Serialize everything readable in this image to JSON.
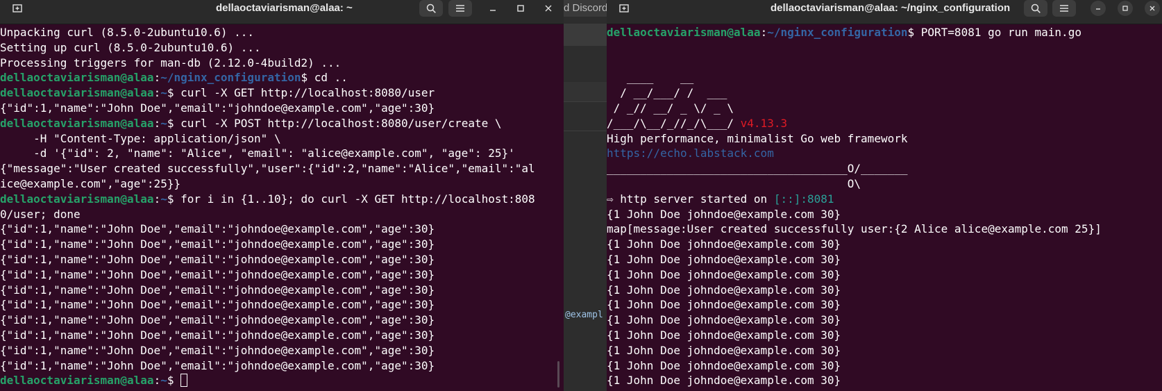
{
  "left": {
    "title": "dellaoctaviarisman@alaa: ~",
    "lines": [
      [
        {
          "t": "Unpacking curl (8.5.0-2ubuntu10.6) ..."
        }
      ],
      [
        {
          "t": "Setting up curl (8.5.0-2ubuntu10.6) ..."
        }
      ],
      [
        {
          "t": "Processing triggers for man-db (2.12.0-4build2) ..."
        }
      ],
      [
        {
          "t": "dellaoctaviarisman@alaa",
          "c": "u"
        },
        {
          "t": ":"
        },
        {
          "t": "~/nginx_configuration",
          "c": "p"
        },
        {
          "t": "$ cd .."
        }
      ],
      [
        {
          "t": "dellaoctaviarisman@alaa",
          "c": "u"
        },
        {
          "t": ":"
        },
        {
          "t": "~",
          "c": "p"
        },
        {
          "t": "$ curl -X GET http://localhost:8080/user"
        }
      ],
      [
        {
          "t": "{\"id\":1,\"name\":\"John Doe\",\"email\":\"johndoe@example.com\",\"age\":30}"
        }
      ],
      [
        {
          "t": "dellaoctaviarisman@alaa",
          "c": "u"
        },
        {
          "t": ":"
        },
        {
          "t": "~",
          "c": "p"
        },
        {
          "t": "$ curl -X POST http://localhost:8080/user/create \\"
        }
      ],
      [
        {
          "t": "     -H \"Content-Type: application/json\" \\"
        }
      ],
      [
        {
          "t": "     -d '{\"id\": 2, \"name\": \"Alice\", \"email\": \"alice@example.com\", \"age\": 25}'"
        }
      ],
      [
        {
          "t": "{\"message\":\"User created successfully\",\"user\":{\"id\":2,\"name\":\"Alice\",\"email\":\"al"
        }
      ],
      [
        {
          "t": "ice@example.com\",\"age\":25}}"
        }
      ],
      [
        {
          "t": "dellaoctaviarisman@alaa",
          "c": "u"
        },
        {
          "t": ":"
        },
        {
          "t": "~",
          "c": "p"
        },
        {
          "t": "$ for i in {1..10}; do curl -X GET http://localhost:808"
        }
      ],
      [
        {
          "t": "0/user; done"
        }
      ],
      [
        {
          "t": "{\"id\":1,\"name\":\"John Doe\",\"email\":\"johndoe@example.com\",\"age\":30}"
        }
      ],
      [
        {
          "t": "{\"id\":1,\"name\":\"John Doe\",\"email\":\"johndoe@example.com\",\"age\":30}"
        }
      ],
      [
        {
          "t": "{\"id\":1,\"name\":\"John Doe\",\"email\":\"johndoe@example.com\",\"age\":30}"
        }
      ],
      [
        {
          "t": "{\"id\":1,\"name\":\"John Doe\",\"email\":\"johndoe@example.com\",\"age\":30}"
        }
      ],
      [
        {
          "t": "{\"id\":1,\"name\":\"John Doe\",\"email\":\"johndoe@example.com\",\"age\":30}"
        }
      ],
      [
        {
          "t": "{\"id\":1,\"name\":\"John Doe\",\"email\":\"johndoe@example.com\",\"age\":30}"
        }
      ],
      [
        {
          "t": "{\"id\":1,\"name\":\"John Doe\",\"email\":\"johndoe@example.com\",\"age\":30}"
        }
      ],
      [
        {
          "t": "{\"id\":1,\"name\":\"John Doe\",\"email\":\"johndoe@example.com\",\"age\":30}"
        }
      ],
      [
        {
          "t": "{\"id\":1,\"name\":\"John Doe\",\"email\":\"johndoe@example.com\",\"age\":30}"
        }
      ],
      [
        {
          "t": "{\"id\":1,\"name\":\"John Doe\",\"email\":\"johndoe@example.com\",\"age\":30}"
        }
      ],
      [
        {
          "t": "dellaoctaviarisman@alaa",
          "c": "u"
        },
        {
          "t": ":"
        },
        {
          "t": "~",
          "c": "p"
        },
        {
          "t": "$ "
        },
        {
          "t": "",
          "c": "cursor"
        }
      ]
    ]
  },
  "middle": {
    "title_fragment": "d Discord",
    "text_fragment": "@exampl"
  },
  "right": {
    "title": "dellaoctaviarisman@alaa: ~/nginx_configuration",
    "lines": [
      [
        {
          "t": "dellaoctaviarisman@alaa",
          "c": "u"
        },
        {
          "t": ":"
        },
        {
          "t": "~/nginx_configuration",
          "c": "p"
        },
        {
          "t": "$ PORT=8081 go run main.go"
        }
      ],
      [
        {
          "t": ""
        }
      ],
      [
        {
          "t": ""
        }
      ],
      [
        {
          "t": "   ____    __"
        }
      ],
      [
        {
          "t": "  / __/___/ /  ___"
        }
      ],
      [
        {
          "t": " / _// __/ _ \\/ _ \\"
        }
      ],
      [
        {
          "t": "/___/\\__/_//_/\\___/ "
        },
        {
          "t": "v4.13.3",
          "c": "red"
        }
      ],
      [
        {
          "t": "High performance, minimalist Go web framework"
        }
      ],
      [
        {
          "t": "https://echo.labstack.com",
          "c": "link"
        }
      ],
      [
        {
          "t": "____________________________________O/_______"
        }
      ],
      [
        {
          "t": "                                    O\\"
        }
      ],
      [
        {
          "t": "⇨ http server started on "
        },
        {
          "t": "[::]:8081",
          "c": "cyan"
        }
      ],
      [
        {
          "t": "{1 John Doe johndoe@example.com 30}"
        }
      ],
      [
        {
          "t": "map[message:User created successfully user:{2 Alice alice@example.com 25}]"
        }
      ],
      [
        {
          "t": "{1 John Doe johndoe@example.com 30}"
        }
      ],
      [
        {
          "t": "{1 John Doe johndoe@example.com 30}"
        }
      ],
      [
        {
          "t": "{1 John Doe johndoe@example.com 30}"
        }
      ],
      [
        {
          "t": "{1 John Doe johndoe@example.com 30}"
        }
      ],
      [
        {
          "t": "{1 John Doe johndoe@example.com 30}"
        }
      ],
      [
        {
          "t": "{1 John Doe johndoe@example.com 30}"
        }
      ],
      [
        {
          "t": "{1 John Doe johndoe@example.com 30}"
        }
      ],
      [
        {
          "t": "{1 John Doe johndoe@example.com 30}"
        }
      ],
      [
        {
          "t": "{1 John Doe johndoe@example.com 30}"
        }
      ],
      [
        {
          "t": "{1 John Doe johndoe@example.com 30}"
        }
      ]
    ]
  },
  "colors": {
    "terminal_bg": "#300a24",
    "user_green": "#26a269",
    "path_blue": "#3465a4",
    "version_red": "#e01b24",
    "address_cyan": "#2aa198"
  },
  "icons": [
    "new-tab-icon",
    "search-icon",
    "menu-icon",
    "minimize-icon",
    "maximize-icon",
    "close-icon"
  ]
}
